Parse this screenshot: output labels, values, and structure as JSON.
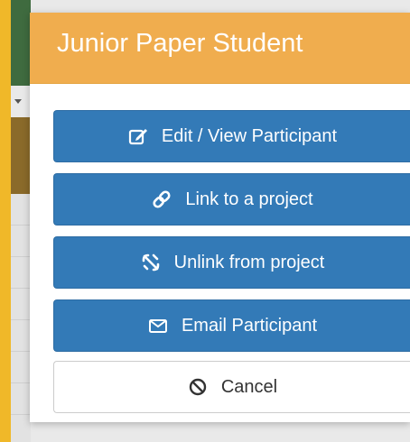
{
  "dialog": {
    "title": "Junior Paper Student",
    "buttons": {
      "edit": {
        "label": "Edit / View Participant",
        "icon": "edit-icon"
      },
      "link": {
        "label": "Link to a project",
        "icon": "link-icon"
      },
      "unlink": {
        "label": "Unlink from project",
        "icon": "unlink-icon"
      },
      "email": {
        "label": "Email Participant",
        "icon": "envelope-icon"
      },
      "cancel": {
        "label": "Cancel",
        "icon": "ban-icon"
      }
    }
  },
  "colors": {
    "header": "#f0ad4e",
    "primary": "#337ab7",
    "backdrop": "#f0b829"
  }
}
